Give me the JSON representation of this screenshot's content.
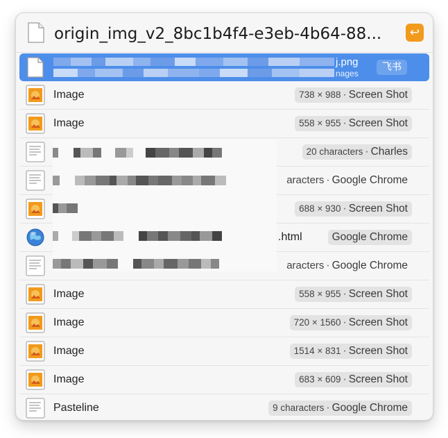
{
  "header": {
    "title": "origin_img_v2_8bc1b4f4-e3eb-4b64-88...",
    "return_symbol": "↩"
  },
  "selected_row": {
    "name_suffix": "j.png",
    "sub_suffix": "nages",
    "tag": "飞书"
  },
  "rows": [
    {
      "label": "Image",
      "dims": "738 × 988",
      "app": "Screen Shot",
      "icon": "image-icon"
    },
    {
      "label": "Image",
      "dims": "558 × 955",
      "app": "Screen Shot",
      "icon": "image-icon"
    },
    {
      "label": "",
      "dims": "20 characters",
      "app": "Charles",
      "icon": "text-doc-icon"
    },
    {
      "label": "",
      "dims": "aracters",
      "app": "Google Chrome",
      "icon": "text-doc-icon"
    },
    {
      "label": "",
      "dims": "688 × 930",
      "app": "Screen Shot",
      "icon": "image-icon"
    },
    {
      "label": "",
      "suffix": ".html",
      "app": "Google Chrome",
      "icon": "globe-icon"
    },
    {
      "label": "",
      "dims": "aracters",
      "app": "Google Chrome",
      "icon": "text-doc-icon"
    },
    {
      "label": "Image",
      "dims": "558 × 955",
      "app": "Screen Shot",
      "icon": "image-icon"
    },
    {
      "label": "Image",
      "dims": "720 × 1560",
      "app": "Screen Shot",
      "icon": "image-icon"
    },
    {
      "label": "Image",
      "dims": "1514 × 831",
      "app": "Screen Shot",
      "icon": "image-icon"
    },
    {
      "label": "Image",
      "dims": "683 × 609",
      "app": "Screen Shot",
      "icon": "image-icon"
    },
    {
      "label": "Pasteline",
      "dims": "9 characters",
      "app": "Google Chrome",
      "icon": "text-doc-icon"
    }
  ],
  "separator": "·",
  "colors": {
    "selection": "#4d8eea",
    "accent": "#f29a1c",
    "image_icon": "#f29a1c"
  }
}
